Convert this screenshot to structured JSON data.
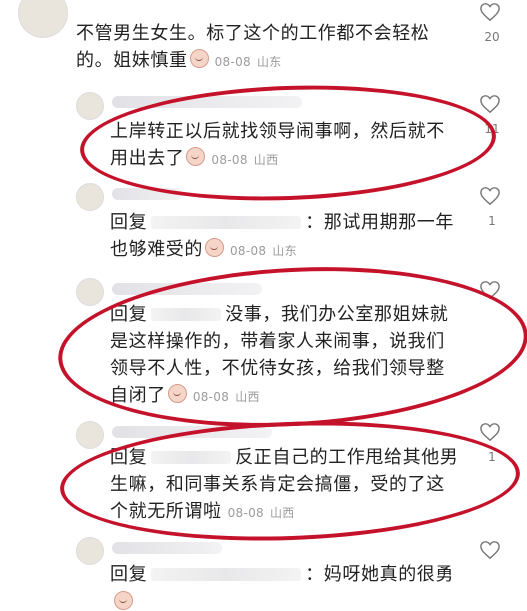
{
  "comments": [
    {
      "text_lines": [
        "不管男生女生。标了这个的工作都不会轻松",
        "的。姐妹慎重"
      ],
      "date": "08-08",
      "location": "山东",
      "likes": "20"
    },
    {
      "text_lines": [
        "上岸转正以后就找领导闹事啊，然后就不",
        "用出去了"
      ],
      "date": "08-08",
      "location": "山西",
      "likes": "11"
    },
    {
      "reply_prefix": "回复",
      "text_lines": [
        "：那试用期那一年",
        "也够难受的"
      ],
      "date": "08-08",
      "location": "山东",
      "likes": "1"
    },
    {
      "reply_prefix": "回复",
      "text_lines": [
        "没事，我们办公室那姐妹就",
        "是这样操作的，带着家人来闹事，说我们",
        "领导不人性，不优待女孩，给我们领导整",
        "自闭了"
      ],
      "date": "08-08",
      "location": "山西",
      "likes": ""
    },
    {
      "reply_prefix": "回复",
      "text_lines": [
        "反正自己的工作甩给其他男",
        "生嘛，和同事关系肯定会搞僵，受的了这",
        "个就无所谓啦"
      ],
      "date": "08-08",
      "location": "山西",
      "likes": "1"
    },
    {
      "reply_prefix": "回复",
      "text_lines": [
        "：妈呀她真的很勇"
      ],
      "date": "",
      "location": "",
      "likes": ""
    }
  ],
  "icons": {
    "like": "heart-outline-icon",
    "emoji": "sticker-emoji-icon"
  },
  "colors": {
    "annotation": "#c5122b",
    "meta": "#9b9b9b"
  }
}
